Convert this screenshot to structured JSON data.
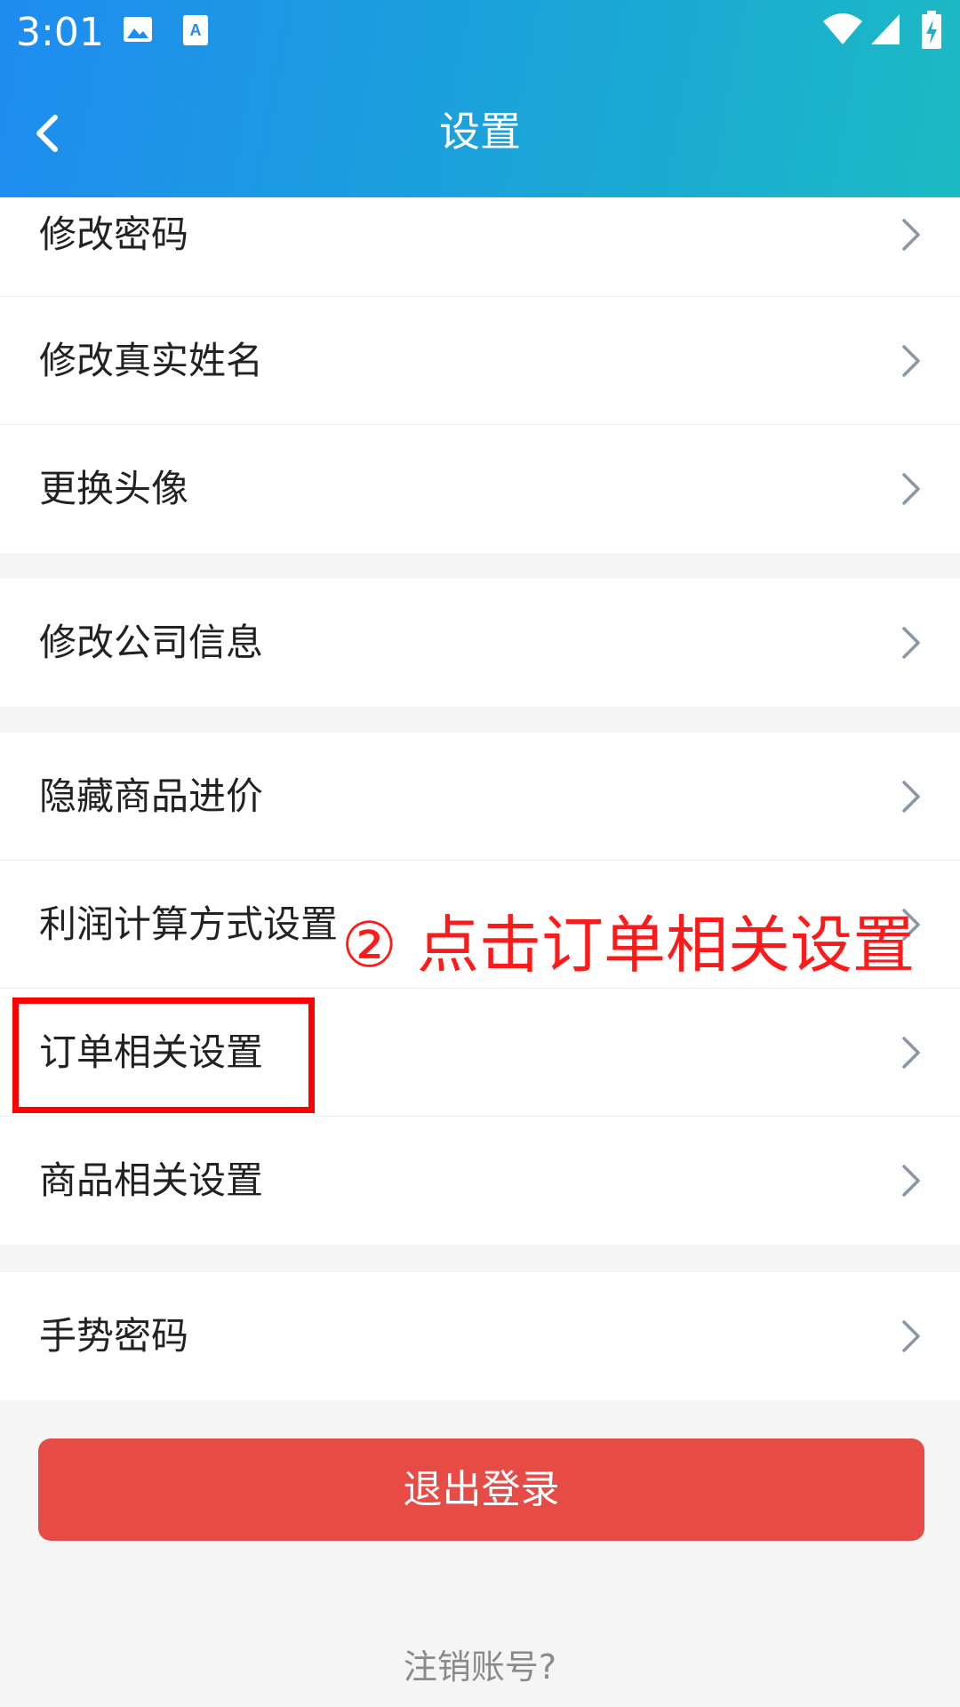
{
  "status_bar": {
    "time": "3:01",
    "icons": [
      "image-icon",
      "text-recognition-icon",
      "wifi-icon",
      "signal-icon",
      "battery-charging-icon"
    ]
  },
  "header": {
    "title": "设置",
    "back_icon": "back-chevron-icon"
  },
  "groups": [
    {
      "items": [
        {
          "label": "修改密码"
        },
        {
          "label": "修改真实姓名"
        },
        {
          "label": "更换头像"
        }
      ]
    },
    {
      "items": [
        {
          "label": "修改公司信息"
        }
      ]
    },
    {
      "items": [
        {
          "label": "隐藏商品进价"
        },
        {
          "label": "利润计算方式设置"
        },
        {
          "label": "订单相关设置"
        },
        {
          "label": "商品相关设置"
        }
      ]
    },
    {
      "items": [
        {
          "label": "手势密码"
        }
      ]
    }
  ],
  "annotation": {
    "text": "② 点击订单相关设置",
    "color": "#ff0000"
  },
  "logout_button": {
    "label": "退出登录",
    "color": "#e64c45"
  },
  "cancel_account_link": {
    "label": "注销账号?"
  },
  "colors": {
    "header_gradient_start": "#1f8cf0",
    "header_gradient_end": "#1cbac4",
    "background": "#f5f5f5"
  }
}
